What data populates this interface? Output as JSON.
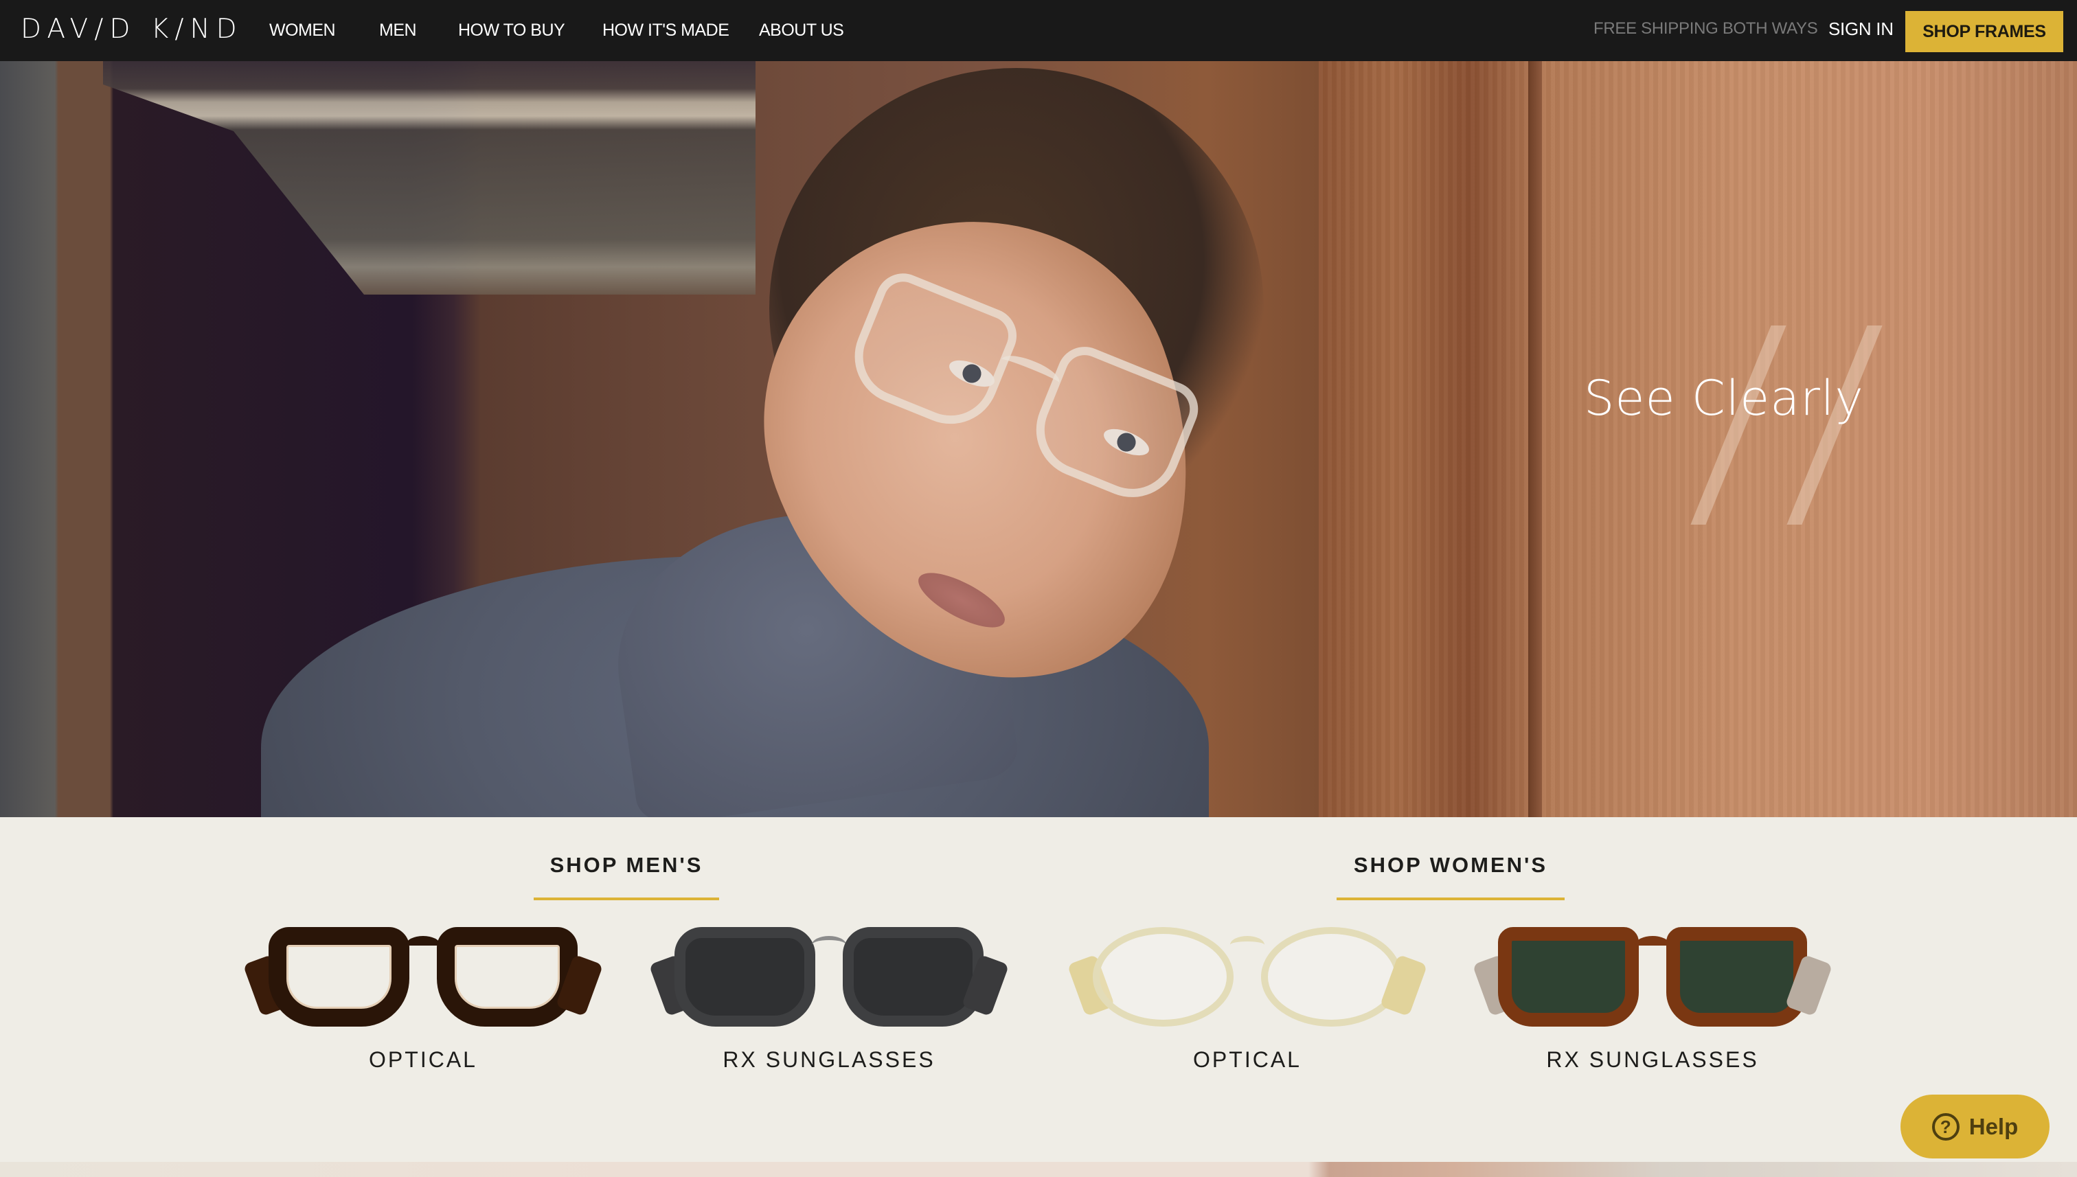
{
  "brand": {
    "logo": "DAV/D K/ND"
  },
  "nav": {
    "items": [
      {
        "label": "WOMEN"
      },
      {
        "label": "MEN"
      },
      {
        "label": "HOW TO BUY"
      },
      {
        "label": "HOW IT'S MADE"
      },
      {
        "label": "ABOUT US"
      }
    ],
    "promo": "FREE SHIPPING BOTH WAYS",
    "sign_in": "SIGN IN",
    "shop_frames": "SHOP FRAMES"
  },
  "hero": {
    "title": "See Clearly",
    "image_alt": "woman-wearing-clear-frame-glasses-in-turtleneck"
  },
  "shop": {
    "mens": {
      "heading": "SHOP MEN'S",
      "tiles": [
        {
          "label": "OPTICAL",
          "frame": "tortoise-optical-frames"
        },
        {
          "label": "RX SUNGLASSES",
          "frame": "grey-sunglasses"
        }
      ]
    },
    "womens": {
      "heading": "SHOP WOMEN'S",
      "tiles": [
        {
          "label": "OPTICAL",
          "frame": "clear-optical-frames"
        },
        {
          "label": "RX SUNGLASSES",
          "frame": "tortoise-sunglasses-green-lens"
        }
      ]
    }
  },
  "help": {
    "label": "Help",
    "icon": "question-circle-icon"
  },
  "colors": {
    "header_bg": "#191919",
    "accent": "#dcb336",
    "section_bg": "#efede6",
    "text_dark": "#1d1d1b",
    "promo_text": "#7a7a7a"
  }
}
